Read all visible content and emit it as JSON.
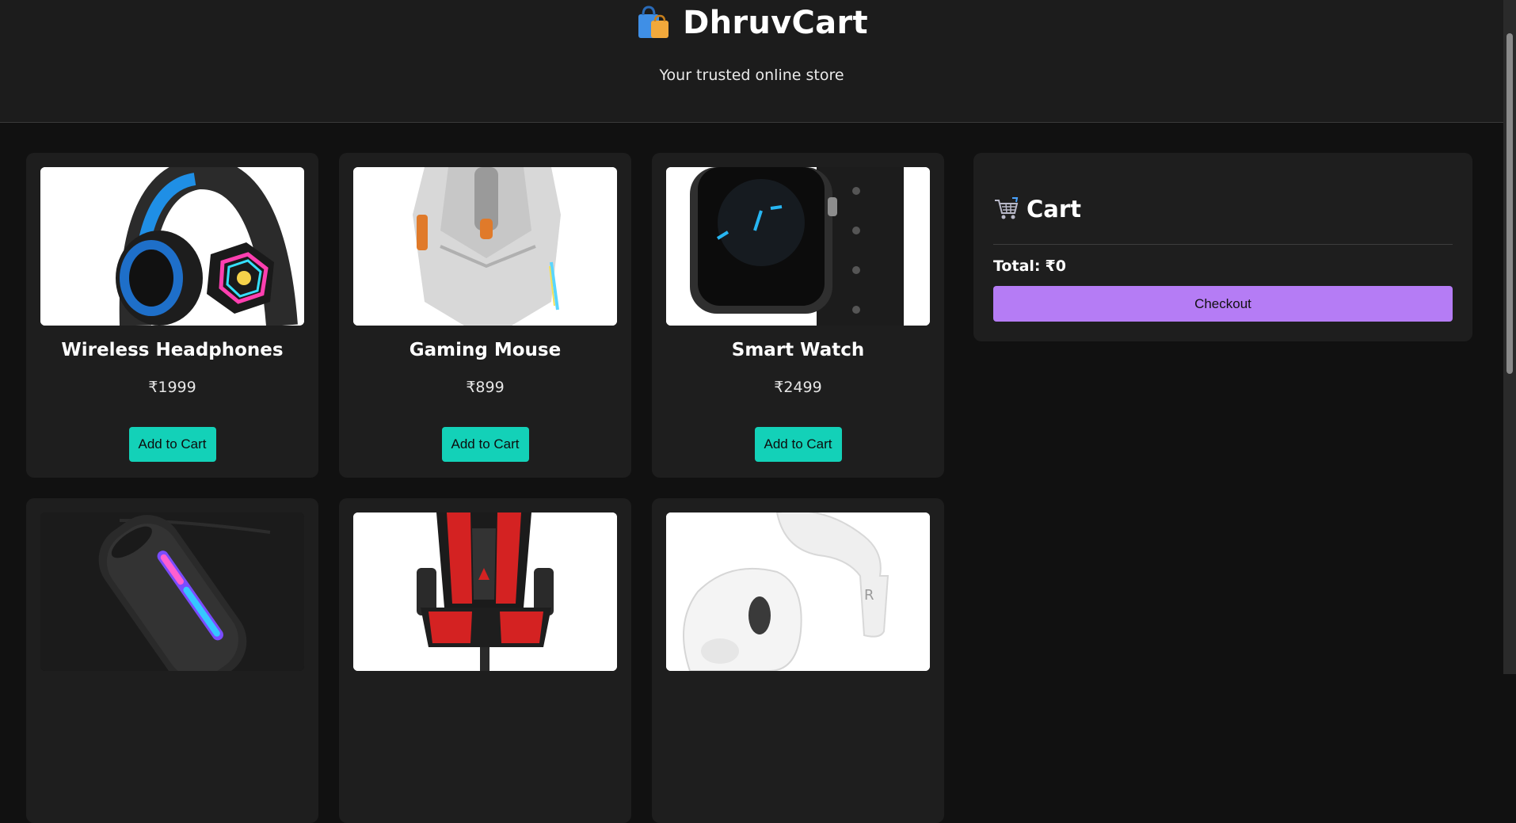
{
  "header": {
    "brand_icon": "shopping-bags-icon",
    "title": "DhruvCart",
    "tagline": "Your trusted online store"
  },
  "products": [
    {
      "name": "Wireless Headphones",
      "price": "₹1999",
      "button": "Add to Cart",
      "image": "headphones-image"
    },
    {
      "name": "Gaming Mouse",
      "price": "₹899",
      "button": "Add to Cart",
      "image": "mouse-image"
    },
    {
      "name": "Smart Watch",
      "price": "₹2499",
      "button": "Add to Cart",
      "image": "smartwatch-image"
    },
    {
      "name": "",
      "price": "",
      "button": "",
      "image": "bluetooth-speaker-image"
    },
    {
      "name": "",
      "price": "",
      "button": "",
      "image": "gaming-chair-image"
    },
    {
      "name": "",
      "price": "",
      "button": "",
      "image": "earbuds-image"
    }
  ],
  "cart": {
    "icon": "shopping-cart-icon",
    "title": "Cart",
    "total_label": "Total:",
    "total_value": "₹0",
    "checkout_label": "Checkout"
  },
  "colors": {
    "background": "#111111",
    "panel": "#1e1e1e",
    "add_button": "#13d1b8",
    "checkout_button": "#b57cf5"
  }
}
